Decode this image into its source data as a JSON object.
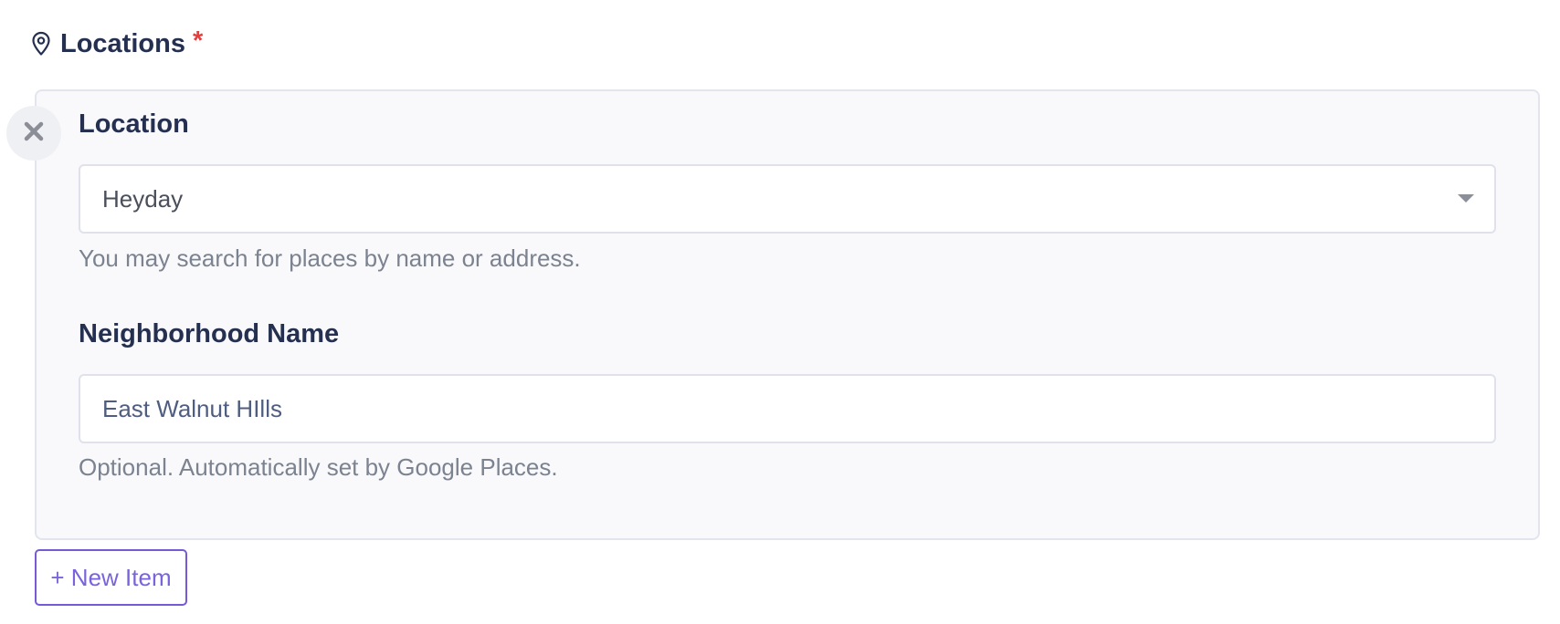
{
  "field": {
    "title": "Locations",
    "required_marker": "*",
    "icon": "map-pin-icon"
  },
  "item": {
    "remove_icon": "close-icon",
    "location": {
      "label": "Location",
      "value": "Heyday",
      "help": "You may search for places by name or address."
    },
    "neighborhood": {
      "label": "Neighborhood Name",
      "value": "East Walnut HIlls",
      "help": "Optional. Automatically set by Google Places."
    }
  },
  "actions": {
    "new_item_label": "+ New Item"
  },
  "colors": {
    "heading": "#253050",
    "required": "#e53e3e",
    "accent": "#7759d6",
    "help_text": "#7b8290"
  }
}
